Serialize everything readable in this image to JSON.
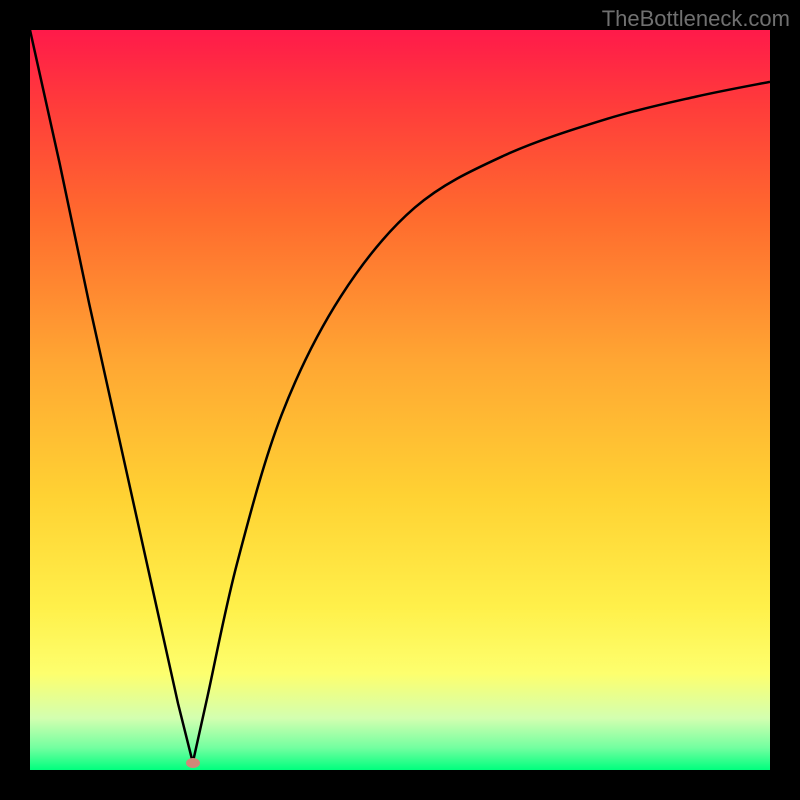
{
  "watermark": "TheBottleneck.com",
  "chart_data": {
    "type": "line",
    "title": "",
    "xlabel": "",
    "ylabel": "",
    "xlim": [
      0,
      100
    ],
    "ylim": [
      0,
      100
    ],
    "minimum_point": {
      "x": 22,
      "y": 1
    },
    "series": [
      {
        "name": "curve-left",
        "x": [
          0,
          4,
          8,
          12,
          16,
          20,
          22
        ],
        "y": [
          100,
          82,
          63,
          45,
          27,
          9,
          1
        ]
      },
      {
        "name": "curve-right",
        "x": [
          22,
          24,
          28,
          34,
          42,
          52,
          64,
          78,
          90,
          100
        ],
        "y": [
          1,
          10,
          28,
          48,
          64,
          76,
          83,
          88,
          91,
          93
        ]
      }
    ],
    "marker": {
      "x": 22,
      "y": 1,
      "color": "#d08878"
    },
    "gradient_stops": [
      {
        "pos": 0,
        "color": "#ff1a4a"
      },
      {
        "pos": 10,
        "color": "#ff3b3b"
      },
      {
        "pos": 25,
        "color": "#ff6a2e"
      },
      {
        "pos": 45,
        "color": "#ffa733"
      },
      {
        "pos": 63,
        "color": "#ffd233"
      },
      {
        "pos": 78,
        "color": "#fff04a"
      },
      {
        "pos": 87,
        "color": "#fdff6e"
      },
      {
        "pos": 93,
        "color": "#d3ffb0"
      },
      {
        "pos": 97,
        "color": "#73ffa0"
      },
      {
        "pos": 100,
        "color": "#00ff7e"
      }
    ]
  }
}
